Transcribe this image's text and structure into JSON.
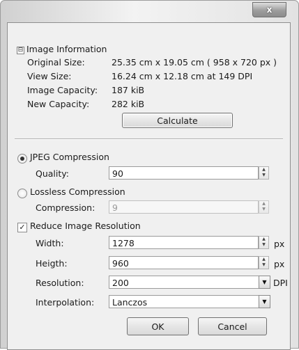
{
  "titlebar": {
    "close_glyph": "x"
  },
  "image_info": {
    "expander": "⊟",
    "title": "Image Information",
    "rows": [
      {
        "label": "Original Size:",
        "value": "25.35 cm x 19.05 cm ( 958 x 720 px )"
      },
      {
        "label": "View Size:",
        "value": "16.24 cm x 12.18 cm at 149 DPI"
      },
      {
        "label": "Image Capacity:",
        "value": "187 kiB"
      },
      {
        "label": "New Capacity:",
        "value": "282 kiB"
      }
    ],
    "calculate_label": "Calculate"
  },
  "jpeg": {
    "label": "JPEG Compression",
    "selected": true,
    "quality_label": "Quality:",
    "quality_value": "90"
  },
  "lossless": {
    "label": "Lossless Compression",
    "selected": false,
    "compression_label": "Compression:",
    "compression_value": "9"
  },
  "reduce": {
    "label": "Reduce Image Resolution",
    "checked": true,
    "check_glyph": "✓",
    "width_label": "Width:",
    "width_value": "1278",
    "width_unit": "px",
    "height_label": "Heigth:",
    "height_value": "960",
    "height_unit": "px",
    "resolution_label": "Resolution:",
    "resolution_value": "200",
    "resolution_unit": "DPI",
    "interpolation_label": "Interpolation:",
    "interpolation_value": "Lanczos"
  },
  "buttons": {
    "ok": "OK",
    "cancel": "Cancel"
  },
  "icons": {
    "spin_up": "▲",
    "spin_down": "▼",
    "dropdown": "▼"
  }
}
